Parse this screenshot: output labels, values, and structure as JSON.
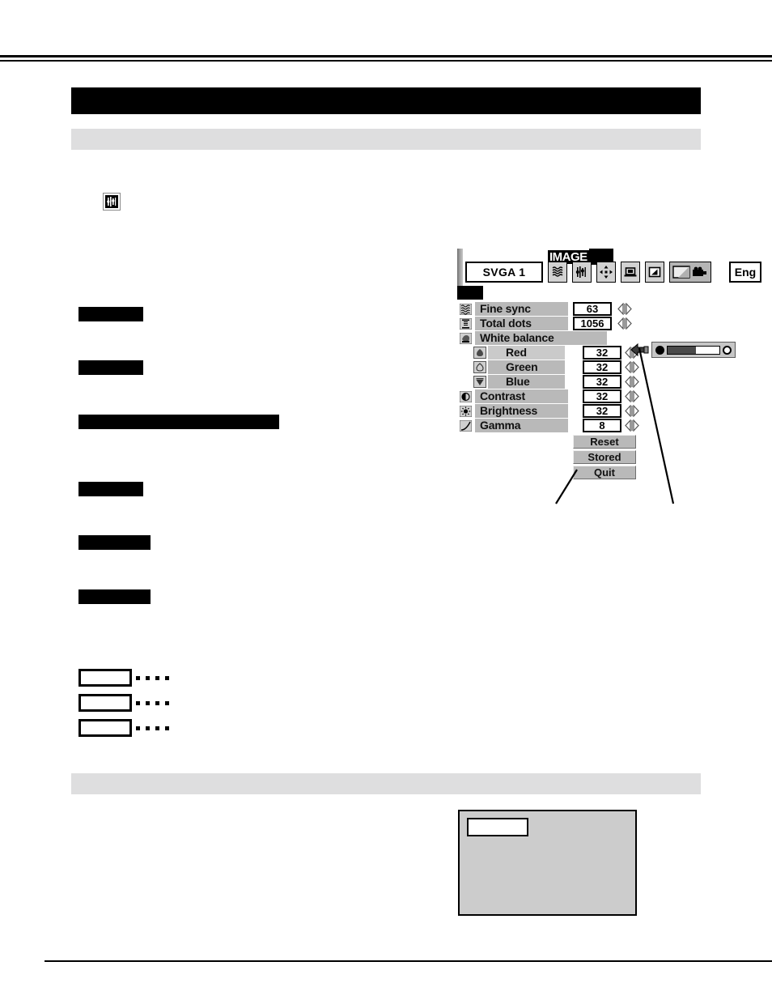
{
  "document": {
    "section_title_redacted": true,
    "header_band_label": "",
    "inline_icon": "tracking-icon"
  },
  "osd": {
    "title": "IMAGE",
    "source": "SVGA 1",
    "language": "Eng",
    "toolbar_icons": [
      "system-icon",
      "tracking-icon",
      "position-icon",
      "screen-icon",
      "pc-adjust-icon",
      "image-adjust-icon"
    ],
    "selected_toolbar_icon": "image-adjust-icon",
    "rows": [
      {
        "icon": "fine-sync-icon",
        "label": "Fine sync",
        "value": "63",
        "type": "value"
      },
      {
        "icon": "total-dots-icon",
        "label": "Total dots",
        "value": "1056",
        "type": "value"
      },
      {
        "icon": "white-balance-icon",
        "label": "White balance",
        "value": "",
        "type": "header"
      },
      {
        "icon": "red-icon",
        "label": "Red",
        "value": "32",
        "type": "sub",
        "selected": true
      },
      {
        "icon": "green-icon",
        "label": "Green",
        "value": "32",
        "type": "sub"
      },
      {
        "icon": "blue-icon",
        "label": "Blue",
        "value": "32",
        "type": "sub"
      },
      {
        "icon": "contrast-icon",
        "label": "Contrast",
        "value": "32",
        "type": "value"
      },
      {
        "icon": "brightness-icon",
        "label": "Brightness",
        "value": "32",
        "type": "value"
      },
      {
        "icon": "gamma-icon",
        "label": "Gamma",
        "value": "8",
        "type": "value"
      }
    ],
    "buttons": [
      {
        "label": "Reset"
      },
      {
        "label": "Stored"
      },
      {
        "label": "Quit"
      }
    ],
    "slider": {
      "name": "level-slider",
      "fill_percent": 55
    }
  },
  "colors": {
    "menu_row": "#b9b9b9",
    "menu_row_highlight": "#cacaca",
    "band": "#dededf",
    "panel": "#cccccc",
    "redaction": "#000000"
  }
}
